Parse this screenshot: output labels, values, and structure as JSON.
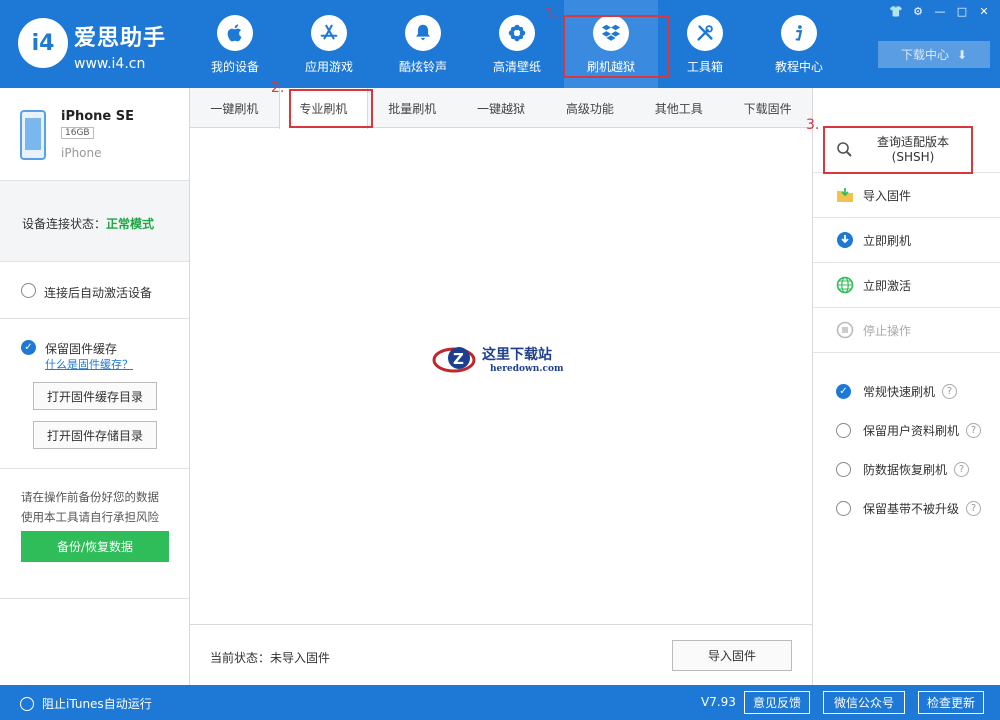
{
  "app": {
    "logo_text": "i4",
    "brand_name": "爱思助手",
    "brand_url": "www.i4.cn"
  },
  "nav": [
    {
      "label": "我的设备",
      "icon": "apple-icon"
    },
    {
      "label": "应用游戏",
      "icon": "app-store-icon"
    },
    {
      "label": "酷炫铃声",
      "icon": "bell-icon"
    },
    {
      "label": "高清壁纸",
      "icon": "flower-icon"
    },
    {
      "label": "刷机越狱",
      "icon": "box-icon",
      "active": true
    },
    {
      "label": "工具箱",
      "icon": "tools-icon"
    },
    {
      "label": "教程中心",
      "icon": "info-icon"
    }
  ],
  "window": {
    "download_center": "下载中心",
    "controls": [
      "shirt-icon",
      "gear-icon",
      "minimize-icon",
      "maximize-icon",
      "close-icon"
    ]
  },
  "annotations": {
    "step1": "1.",
    "step2": "2.",
    "step3": "3."
  },
  "device": {
    "name": "iPhone SE",
    "capacity": "16GB",
    "type": "iPhone"
  },
  "left": {
    "conn_label": "设备连接状态：",
    "conn_value": "正常模式",
    "auto_activate": "连接后自动激活设备",
    "keep_cache": "保留固件缓存",
    "what_cache": "什么是固件缓存？",
    "open_cache_dir": "打开固件缓存目录",
    "open_store_dir": "打开固件存储目录",
    "warn_line1": "请在操作前备份好您的数据",
    "warn_line2": "使用本工具请自行承担风险",
    "backup": "备份/恢复数据"
  },
  "tabs": [
    {
      "label": "一键刷机"
    },
    {
      "label": "专业刷机",
      "active": true
    },
    {
      "label": "批量刷机"
    },
    {
      "label": "一键越狱"
    },
    {
      "label": "高级功能"
    },
    {
      "label": "其他工具"
    },
    {
      "label": "下载固件"
    }
  ],
  "watermark": {
    "title": "这里下载站",
    "url": "heredown.com"
  },
  "status": {
    "label": "当前状态：未导入固件",
    "import_button": "导入固件"
  },
  "right": {
    "query_line1": "查询适配版本",
    "query_line2": "(SHSH)",
    "import_firmware": "导入固件",
    "flash_now": "立即刷机",
    "activate_now": "立即激活",
    "stop": "停止操作",
    "opt_quick": "常规快速刷机",
    "opt_keep_data": "保留用户资料刷机",
    "opt_anti_recovery": "防数据恢复刷机",
    "opt_keep_baseband": "保留基带不被升级"
  },
  "bottom": {
    "block_itunes": "阻止iTunes自动运行",
    "version": "V7.93",
    "feedback": "意见反馈",
    "wechat": "微信公众号",
    "update": "检查更新"
  },
  "colors": {
    "primary": "#1e78d6",
    "accent_red": "#d9363e",
    "green": "#2ebd59",
    "status_green": "#22a544"
  }
}
